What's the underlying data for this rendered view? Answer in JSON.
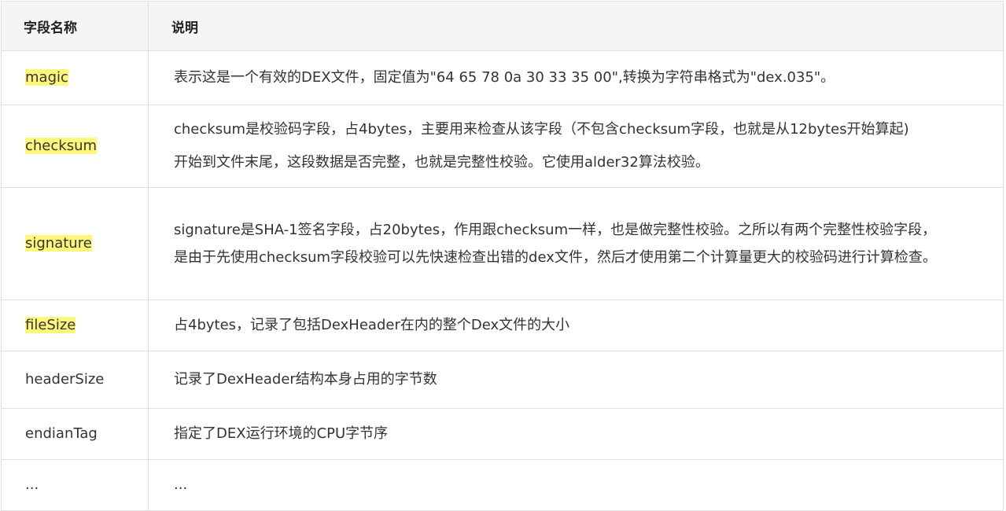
{
  "table": {
    "headers": {
      "name": "字段名称",
      "description": "说明"
    },
    "rows": [
      {
        "name": "magic",
        "highlighted": true,
        "lines": [
          "表示这是一个有效的DEX文件，固定值为\"64 65 78 0a 30 33 35 00\",转换为字符串格式为\"dex.035\"。"
        ]
      },
      {
        "name": "checksum",
        "highlighted": true,
        "lines": [
          "checksum是校验码字段，占4bytes，主要用来检查从该字段（不包含checksum字段，也就是从12bytes开始算起)",
          "开始到文件末尾，这段数据是否完整，也就是完整性校验。它使用alder32算法校验。"
        ]
      },
      {
        "name": "signature",
        "highlighted": true,
        "lines": [
          "signature是SHA-1签名字段，占20bytes，作用跟checksum一样，也是做完整性校验。之所以有两个完整性校验字段，",
          "是由于先使用checksum字段校验可以先快速检查出错的dex文件，然后才使用第二个计算量更大的校验码进行计算检查。"
        ]
      },
      {
        "name": "fileSize",
        "highlighted": true,
        "lines": [
          "占4bytes，记录了包括DexHeader在内的整个Dex文件的大小"
        ]
      },
      {
        "name": "headerSize",
        "highlighted": false,
        "lines": [
          "记录了DexHeader结构本身占用的字节数"
        ]
      },
      {
        "name": "endianTag",
        "highlighted": false,
        "lines": [
          "指定了DEX运行环境的CPU字节序"
        ]
      },
      {
        "name": "...",
        "highlighted": false,
        "lines": [
          "..."
        ]
      }
    ]
  },
  "colors": {
    "header_bg": "#f4f5f7",
    "border": "#dfe2e5",
    "highlight": "#fff77a",
    "text": "#333333"
  }
}
